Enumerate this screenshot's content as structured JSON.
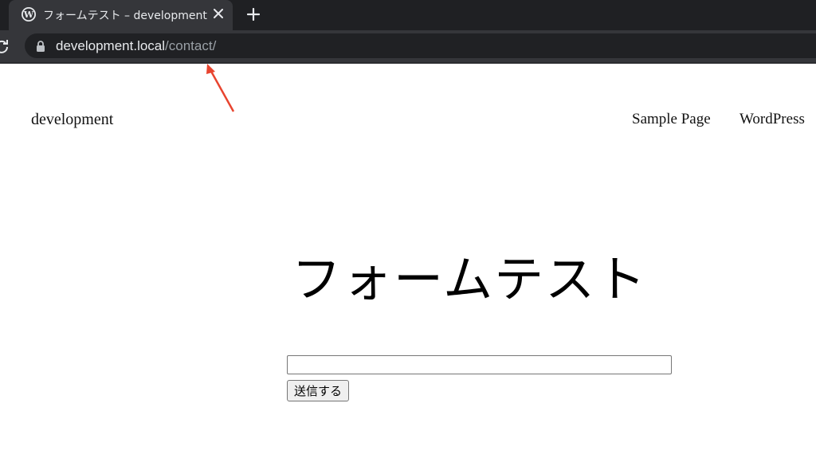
{
  "browser": {
    "tab": {
      "title": "フォームテスト – development",
      "favicon_icon": "wordpress-icon"
    },
    "close_icon": "close-icon",
    "new_tab_icon": "plus-icon",
    "reload_icon": "reload-icon",
    "lock_icon": "lock-icon",
    "url_host": "development.local",
    "url_path": "/contact/"
  },
  "annotation": {
    "icon": "arrow-icon",
    "color": "#e8442f"
  },
  "site": {
    "title": "development",
    "nav": [
      "Sample Page",
      "WordPress"
    ]
  },
  "page": {
    "title": "フォームテスト",
    "input_value": "",
    "submit_label": "送信する"
  }
}
